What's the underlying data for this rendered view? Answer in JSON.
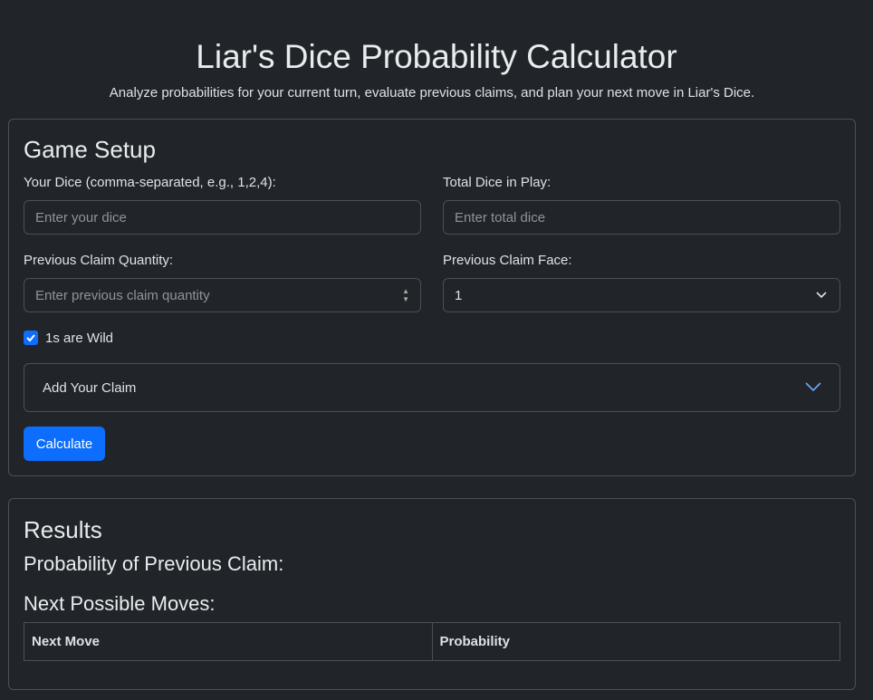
{
  "header": {
    "title": "Liar's Dice Probability Calculator",
    "subtitle": "Analyze probabilities for your current turn, evaluate previous claims, and plan your next move in Liar's Dice."
  },
  "setup": {
    "title": "Game Setup",
    "your_dice_label": "Your Dice (comma-separated, e.g., 1,2,4):",
    "your_dice_placeholder": "Enter your dice",
    "total_dice_label": "Total Dice in Play:",
    "total_dice_placeholder": "Enter total dice",
    "prev_qty_label": "Previous Claim Quantity:",
    "prev_qty_placeholder": "Enter previous claim quantity",
    "prev_face_label": "Previous Claim Face:",
    "prev_face_value": "1",
    "wild_label": "1s are Wild",
    "wild_checked": true,
    "accordion_label": "Add Your Claim",
    "calculate_label": "Calculate"
  },
  "results": {
    "title": "Results",
    "prev_claim_heading": "Probability of Previous Claim:",
    "next_moves_heading": "Next Possible Moves:",
    "columns": [
      "Next Move",
      "Probability"
    ]
  },
  "colors": {
    "accent": "#0d6efd",
    "background": "#212529",
    "border": "#495057"
  }
}
